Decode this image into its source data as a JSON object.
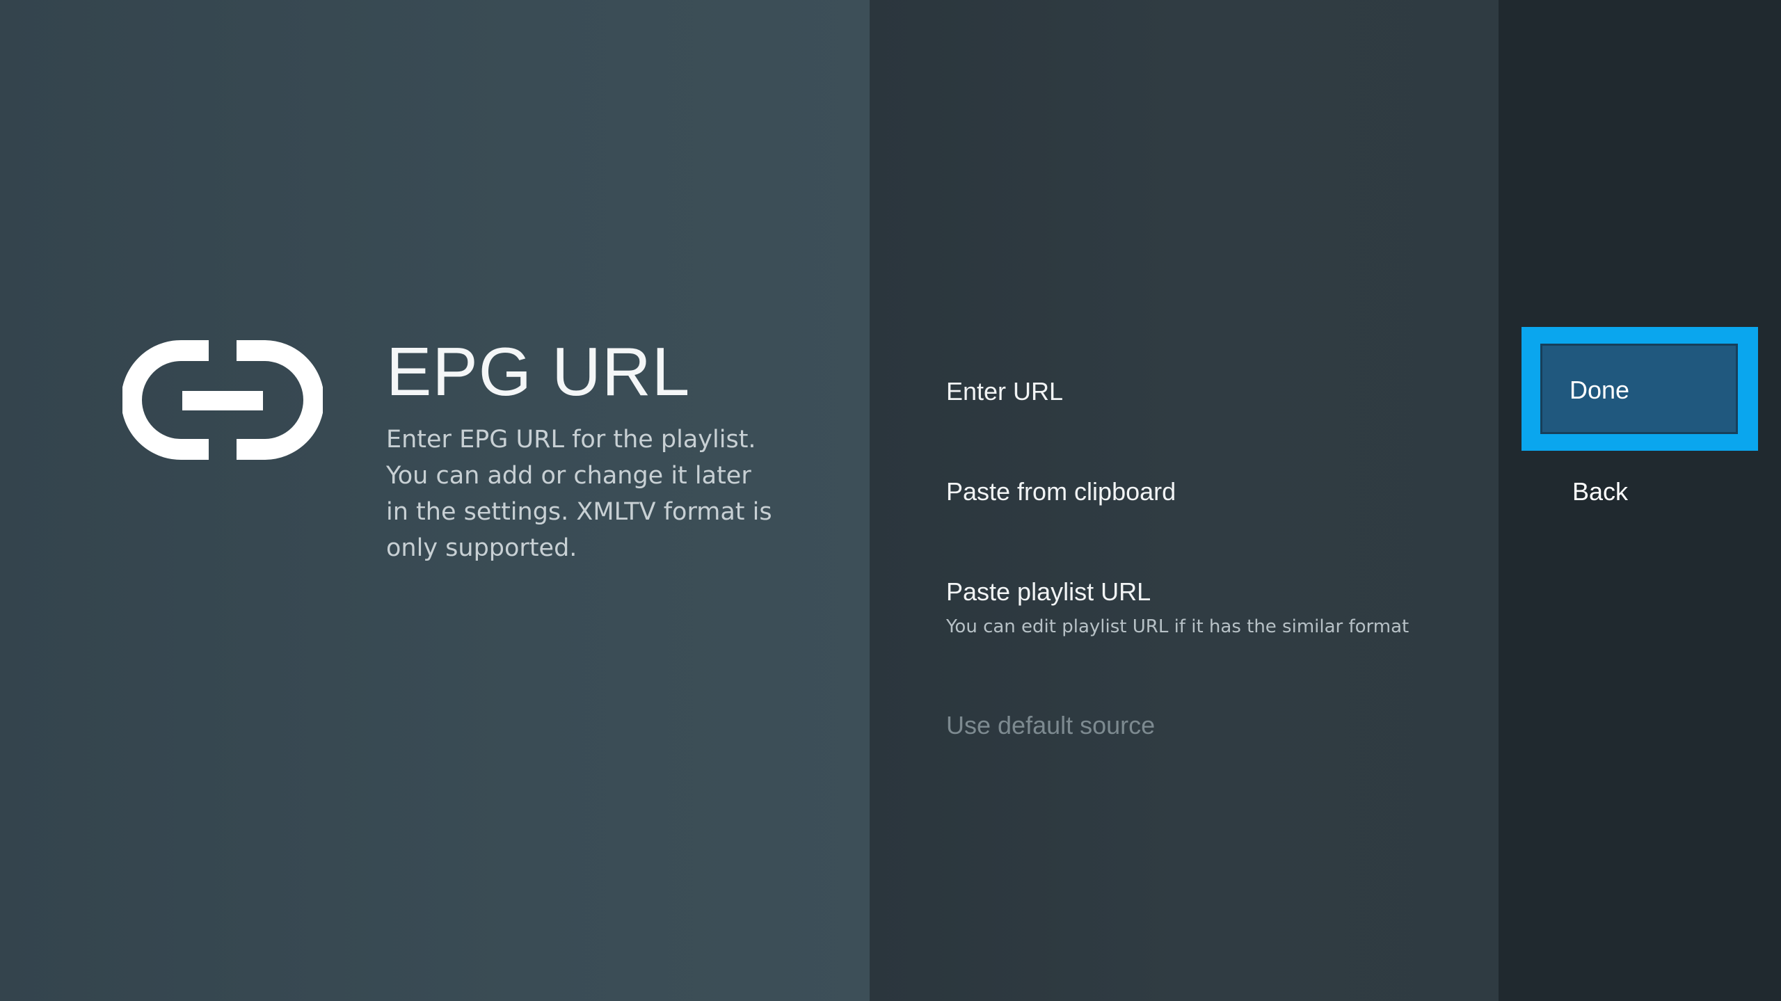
{
  "guidance": {
    "icon": "link-icon",
    "title": "EPG URL",
    "description": "Enter EPG URL for the playlist. You can add or change it later in the settings. XMLTV format is only supported."
  },
  "actions": {
    "items": [
      {
        "title": "Enter URL",
        "description": ""
      },
      {
        "title": "Paste from clipboard",
        "description": ""
      },
      {
        "title": "Paste playlist URL",
        "description": "You can edit playlist URL if it has the similar format"
      },
      {
        "title": "Use default source",
        "description": "",
        "disabled": true
      }
    ]
  },
  "buttons": {
    "done_label": "Done",
    "back_label": "Back"
  },
  "colors": {
    "focus_accent": "#0aa6ee",
    "focused_button": "#20587e",
    "left_panel": "#37474f",
    "middle_panel": "#2f3b42",
    "right_panel": "#20292f"
  }
}
